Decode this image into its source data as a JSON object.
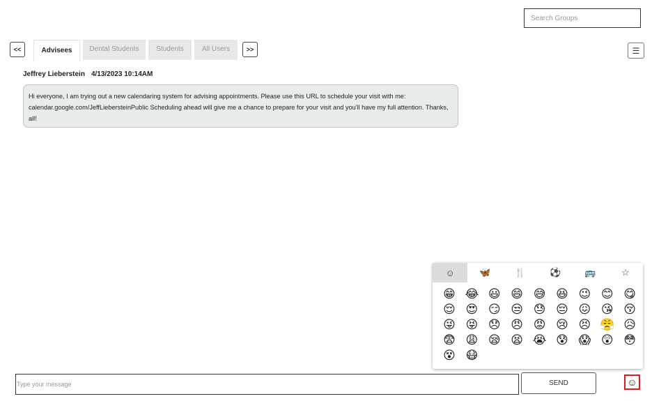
{
  "search": {
    "placeholder": "Search Groups"
  },
  "nav": {
    "prev_label": "<<",
    "next_label": ">>"
  },
  "tabs": [
    {
      "label": "Advisees",
      "active": true
    },
    {
      "label": "Dental Students",
      "active": false
    },
    {
      "label": "Students",
      "active": false
    },
    {
      "label": "All Users",
      "active": false
    }
  ],
  "menu": {
    "icon": "hamburger-menu-icon",
    "glyph": "☰"
  },
  "messages": [
    {
      "author": "Jeffrey Lieberstein",
      "timestamp": "4/13/2023 10:14AM",
      "body": "Hi everyone, I am trying out a new calendaring system for advising appointments. Please use this URL to schedule your visit with me: calendar.google.com/JeffLiebersteinPublic Scheduling ahead will give me a chance to prepare for your visit and you'll have my full attention. Thanks, all!"
    }
  ],
  "emoji_picker": {
    "categories": [
      {
        "icon": "smiley-category-icon",
        "glyph": "☺",
        "active": true
      },
      {
        "icon": "butterfly-category-icon",
        "glyph": "🦋",
        "active": false
      },
      {
        "icon": "utensils-category-icon",
        "glyph": "🍴",
        "active": false
      },
      {
        "icon": "ball-category-icon",
        "glyph": "⚽",
        "active": false
      },
      {
        "icon": "bus-category-icon",
        "glyph": "🚌",
        "active": false
      },
      {
        "icon": "star-category-icon",
        "glyph": "☆",
        "active": false
      }
    ],
    "emojis": [
      "😁",
      "😂",
      "😃",
      "😄",
      "😅",
      "😆",
      "😉",
      "😊",
      "😋",
      "😌",
      "😍",
      "😏",
      "😒",
      "😓",
      "😔",
      "😖",
      "😘",
      "😚",
      "😜",
      "😝",
      "😞",
      "😠",
      "😡",
      "😢",
      "😣",
      "😤",
      "😥",
      "😨",
      "😩",
      "😪",
      "😫",
      "😭",
      "😰",
      "😱",
      "😲",
      "😳",
      "😵",
      "😷"
    ]
  },
  "composer": {
    "placeholder": "Type your message",
    "send_label": "SEND",
    "emoji_button_icon": "smiley-icon",
    "emoji_button_glyph": "☺"
  }
}
